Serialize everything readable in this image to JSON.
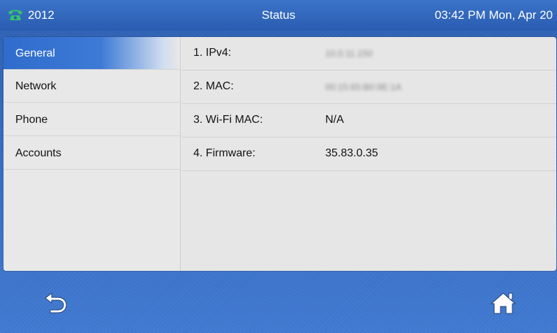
{
  "topbar": {
    "phone_icon": "phone-handset-icon",
    "extension": "2012",
    "title": "Status",
    "datetime": "03:42 PM Mon, Apr 20",
    "icon_color": "#36c26a"
  },
  "sidebar": {
    "items": [
      {
        "label": "General",
        "active": true
      },
      {
        "label": "Network",
        "active": false
      },
      {
        "label": "Phone",
        "active": false
      },
      {
        "label": "Accounts",
        "active": false
      }
    ]
  },
  "details": {
    "rows": [
      {
        "label": "1. IPv4:",
        "value": "10.0.11.150",
        "blurred": true
      },
      {
        "label": "2. MAC:",
        "value": "00:15:65:B0:9E:1A",
        "blurred": true
      },
      {
        "label": "3. Wi-Fi MAC:",
        "value": "N/A",
        "blurred": false
      },
      {
        "label": "4. Firmware:",
        "value": "35.83.0.35",
        "blurred": false
      }
    ]
  },
  "bottombar": {
    "back_icon": "back-arrow-icon",
    "home_icon": "home-icon"
  },
  "colors": {
    "accent": "#2f6ccc",
    "background": "#2f63b5",
    "panel": "#e6e6e6"
  }
}
